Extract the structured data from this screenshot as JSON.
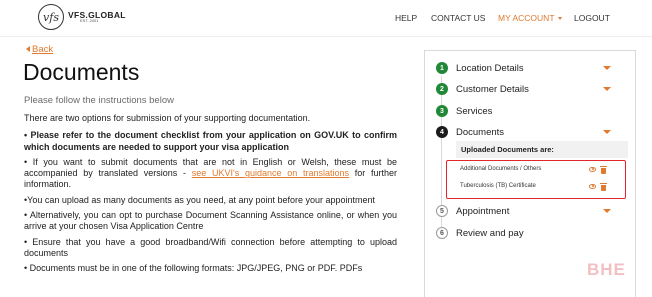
{
  "header": {
    "logo": {
      "name": "VFS.GLOBAL",
      "mark": "vfs",
      "est": "EST. 2001"
    },
    "nav": [
      {
        "label": "HELP"
      },
      {
        "label": "CONTACT US"
      },
      {
        "label": "MY ACCOUNT",
        "active": true
      },
      {
        "label": "LOGOUT"
      }
    ]
  },
  "main": {
    "back_label": "Back",
    "title": "Documents",
    "subtitle": "Please follow the instructions below",
    "paragraphs": {
      "p1": "There are two options for submission of your supporting documentation.",
      "p2": "• Please refer to the document checklist from your application on GOV.UK to confirm which documents are needed to support your visa application",
      "p3_before": "• If you want to submit documents that are not in English or Welsh, these must be accompanied by translated versions - ",
      "p3_link": "see UKVI's guidance on translations",
      "p3_after": " for further information.",
      "p4": "•You can upload as many documents as you need, at any point before your appointment",
      "p5": "• Alternatively, you can opt to purchase Document Scanning Assistance online, or when you arrive at your chosen Visa Application Centre",
      "p6": "• Ensure that you have a good broadband/Wifi connection before attempting to upload documents",
      "p7": "• Documents must be in one of the following formats: JPG/JPEG, PNG or PDF. PDFs"
    }
  },
  "steps": [
    {
      "number": "1",
      "label": "Location Details",
      "state": "complete"
    },
    {
      "number": "2",
      "label": "Customer Details",
      "state": "complete"
    },
    {
      "number": "3",
      "label": "Services",
      "state": "complete"
    },
    {
      "number": "4",
      "label": "Documents",
      "state": "current"
    },
    {
      "number": "5",
      "label": "Appointment",
      "state": "pending"
    },
    {
      "number": "6",
      "label": "Review and pay",
      "state": "pending"
    }
  ],
  "uploaded": {
    "header": "Uploaded Documents are:",
    "documents": [
      {
        "name": "Additional Documents / Others"
      },
      {
        "name": "Tuberculosis (TB) Certificate"
      }
    ]
  },
  "watermark": "BHE",
  "colors": {
    "accent": "#e07a2f",
    "complete": "#218838",
    "highlight": "#e3262d"
  }
}
